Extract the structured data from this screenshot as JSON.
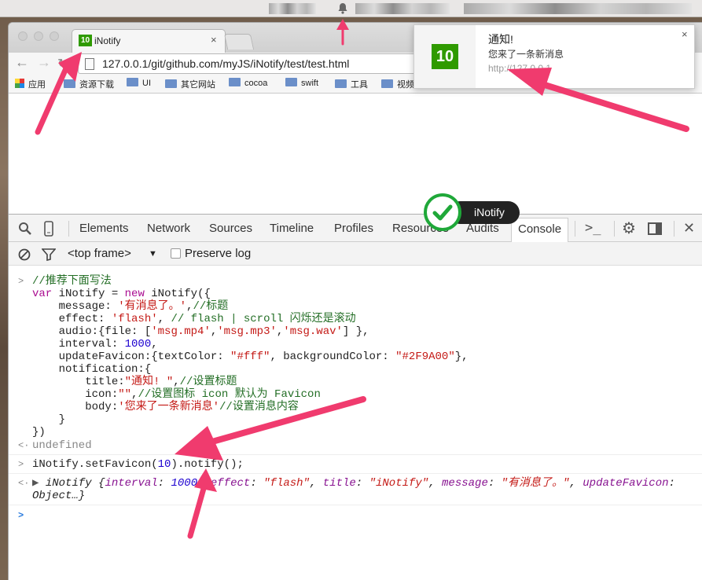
{
  "menubar": {
    "icon": "bell-icon"
  },
  "browser": {
    "tab": {
      "favicon_text": "10",
      "title": "iNotify",
      "close": "×"
    },
    "url": "127.0.0.1/git/github.com/myJS/iNotify/test/test.html",
    "bookmarks": [
      "应用",
      "资源下载",
      "UI",
      "其它网站",
      "cocoa",
      "swift",
      "工具",
      "视频"
    ]
  },
  "notification": {
    "favicon_text": "10",
    "title": "通知!",
    "message": "您来了一条新消息",
    "origin": "http://127.0.0.1",
    "close": "×"
  },
  "toast": {
    "label": "iNotify"
  },
  "devtools": {
    "tabs": [
      "Elements",
      "Network",
      "Sources",
      "Timeline",
      "Profiles",
      "Resources",
      "Audits",
      "Console"
    ],
    "selected_tab": "Console",
    "frame": "<top frame>",
    "preserve_log": "Preserve log"
  },
  "colors": {
    "favicon_bg": "#2F9A00",
    "arrow": "#F03B6E",
    "check": "#1FA839"
  }
}
